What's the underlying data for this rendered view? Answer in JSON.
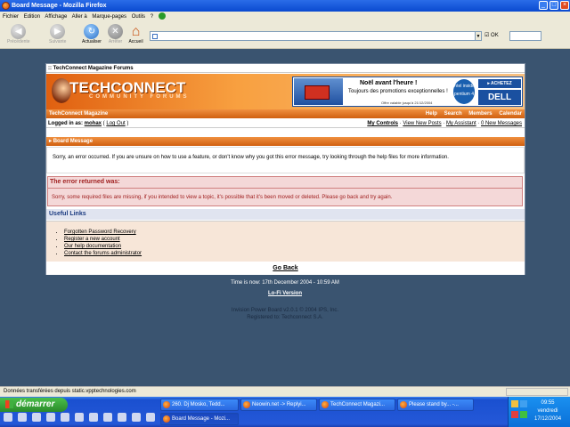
{
  "window": {
    "title": "Board Message - Mozilla Firefox"
  },
  "menu": [
    "Fichier",
    "Edition",
    "Affichage",
    "Aller à",
    "Marque-pages",
    "Outils",
    "?"
  ],
  "nav": {
    "back": "Précédente",
    "forward": "Suivante",
    "reload": "Actualiser",
    "stop": "Arrêter",
    "home": "Accueil",
    "ok": "OK"
  },
  "crumb": ":: TechConnect Magazine Forums",
  "logo": {
    "main": "TECHCONNECT",
    "sub": "COMMUNITY FORUMS"
  },
  "ad": {
    "title": "Noël avant l'heure !",
    "text": "Toujours des promotions exceptionnelles !",
    "note": "Offre valable jusqu'à 21/12/2004",
    "intel": "intel inside pentium 4",
    "buy": "▸ ACHETEZ",
    "brand": "DELL"
  },
  "orangebar": {
    "site": "TechConnect Magazine",
    "links": [
      "Help",
      "Search",
      "Members",
      "Calendar"
    ]
  },
  "userbar": {
    "logged_prefix": "Logged in as:",
    "user": "mohax",
    "logout": "Log Out",
    "links": [
      "My Controls",
      "View New Posts",
      "My Assistant",
      "0 New Messages"
    ]
  },
  "message": {
    "head": "Board Message",
    "body": "Sorry, an error occurred. If you are unsure on how to use a feature, or don't know why you got this error message, try looking through the help files for more information."
  },
  "error": {
    "title": "The error returned was:",
    "text": "Sorry, some required files are missing, if you intended to view a topic, it's possible that it's been moved or deleted. Please go back and try again."
  },
  "useful": {
    "head": "Useful Links",
    "links": [
      "Forgotten Password Recovery",
      "Register a new account",
      "Our help documentation",
      "Contact the forums administrator"
    ]
  },
  "goback": "Go Back",
  "footer": {
    "time": "Time is now: 17th December 2004 - 10:59 AM",
    "lofi": "Lo-Fi Version",
    "copyright": "Invision Power Board v2.0.1 © 2004  IPS, Inc.",
    "registered": "Registered to: Techconnect S.A."
  },
  "status": "Données transférées depuis static.vpptechnologies.com",
  "taskbar": {
    "start": "démarrer",
    "row1": [
      "260. Dj Mosko, Tedd...",
      "Neowin.net -> Replyi...",
      "TechConnect Magazi...",
      "Please stand by... -..."
    ],
    "row2": [
      "Board Message - Mozi..."
    ]
  },
  "clock": {
    "time": "09:55",
    "day": "vendredi",
    "date": "17/12/2004"
  }
}
